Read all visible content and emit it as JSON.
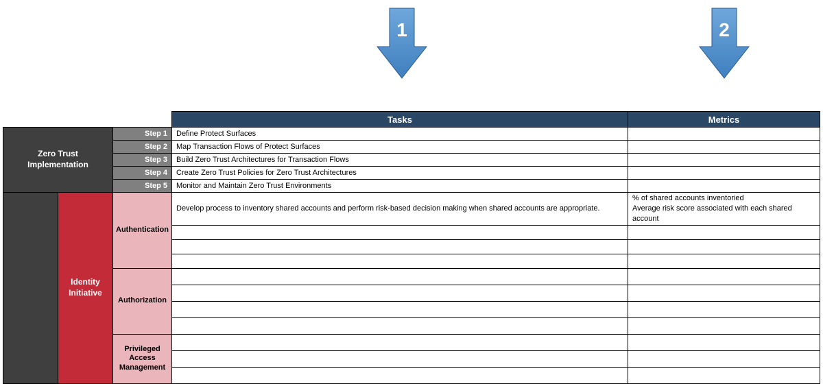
{
  "arrows": {
    "a1": "1",
    "a2": "2"
  },
  "headers": {
    "tasks": "Tasks",
    "metrics": "Metrics"
  },
  "zt_impl_label_l1": "Zero Trust",
  "zt_impl_label_l2": "Implementation",
  "steps": [
    {
      "label": "Step 1",
      "task": "Define Protect Surfaces"
    },
    {
      "label": "Step 2",
      "task": "Map Transaction Flows of Protect Surfaces"
    },
    {
      "label": "Step 3",
      "task": "Build Zero Trust Architectures for Transaction Flows"
    },
    {
      "label": "Step 4",
      "task": "Create Zero Trust Policies for Zero Trust Architectures"
    },
    {
      "label": "Step 5",
      "task": "Monitor and Maintain Zero Trust Environments"
    }
  ],
  "identity_label_l1": "Identity",
  "identity_label_l2": "Initiative",
  "sections": {
    "auth": {
      "label": "Authentication",
      "rows": [
        {
          "task": "Develop process to inventory shared accounts and perform risk-based decision making when shared accounts are appropriate.",
          "metric_l1": "% of shared accounts inventoried",
          "metric_l2": "Average risk score associated with each shared account"
        },
        {
          "task": "",
          "metric_l1": "",
          "metric_l2": ""
        },
        {
          "task": "",
          "metric_l1": "",
          "metric_l2": ""
        },
        {
          "task": "",
          "metric_l1": "",
          "metric_l2": ""
        }
      ]
    },
    "authz": {
      "label": "Authorization",
      "rows": [
        {
          "task": "",
          "metric_l1": "",
          "metric_l2": ""
        },
        {
          "task": "",
          "metric_l1": "",
          "metric_l2": ""
        },
        {
          "task": "",
          "metric_l1": "",
          "metric_l2": ""
        },
        {
          "task": "",
          "metric_l1": "",
          "metric_l2": ""
        }
      ]
    },
    "pam": {
      "label_l1": "Privileged",
      "label_l2": "Access",
      "label_l3": "Management",
      "rows": [
        {
          "task": "",
          "metric_l1": "",
          "metric_l2": ""
        },
        {
          "task": "",
          "metric_l1": "",
          "metric_l2": ""
        },
        {
          "task": "",
          "metric_l1": "",
          "metric_l2": ""
        }
      ]
    }
  }
}
